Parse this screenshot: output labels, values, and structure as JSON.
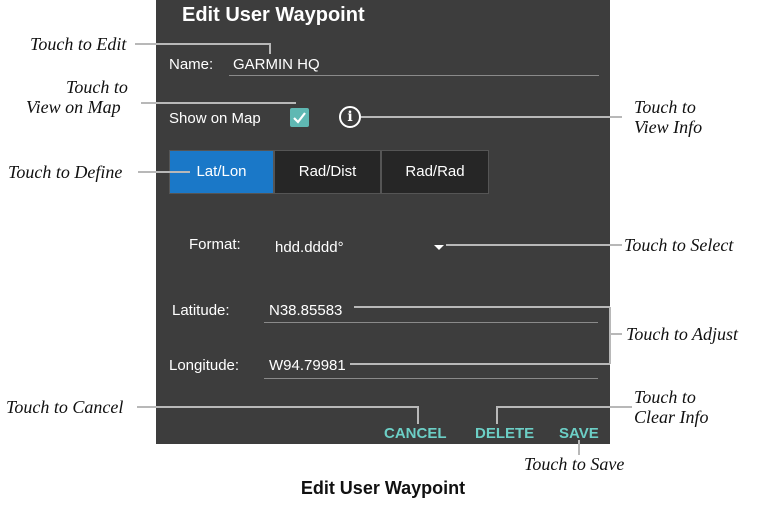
{
  "dialog": {
    "title": "Edit User Waypoint",
    "name_label": "Name:",
    "name_value": "GARMIN HQ",
    "show_on_map_label": "Show on Map",
    "show_on_map_checked": true,
    "info_icon_glyph": "i",
    "tabs": [
      {
        "label": "Lat/Lon",
        "active": true
      },
      {
        "label": "Rad/Dist",
        "active": false
      },
      {
        "label": "Rad/Rad",
        "active": false
      }
    ],
    "format_label": "Format:",
    "format_value": "hdd.dddd°",
    "latitude_label": "Latitude:",
    "latitude_value": "N38.85583",
    "longitude_label": "Longitude:",
    "longitude_value": "W94.79981",
    "actions": {
      "cancel": "CANCEL",
      "delete": "DELETE",
      "save": "SAVE"
    }
  },
  "callouts": {
    "edit": "Touch to Edit",
    "view_on_map_line1": "Touch to",
    "view_on_map_line2": "View on Map",
    "view_info_line1": "Touch to",
    "view_info_line2": "View Info",
    "define": "Touch to Define",
    "select": "Touch to Select",
    "adjust": "Touch to Adjust",
    "cancel": "Touch to Cancel",
    "clear_info_line1": "Touch to",
    "clear_info_line2": "Clear Info",
    "save": "Touch to Save"
  },
  "caption": "Edit User Waypoint",
  "colors": {
    "panel_bg": "#3d3d3d",
    "active_tab": "#1a78c8",
    "accent": "#6ccfc6",
    "checkbox": "#5fb8b3"
  }
}
